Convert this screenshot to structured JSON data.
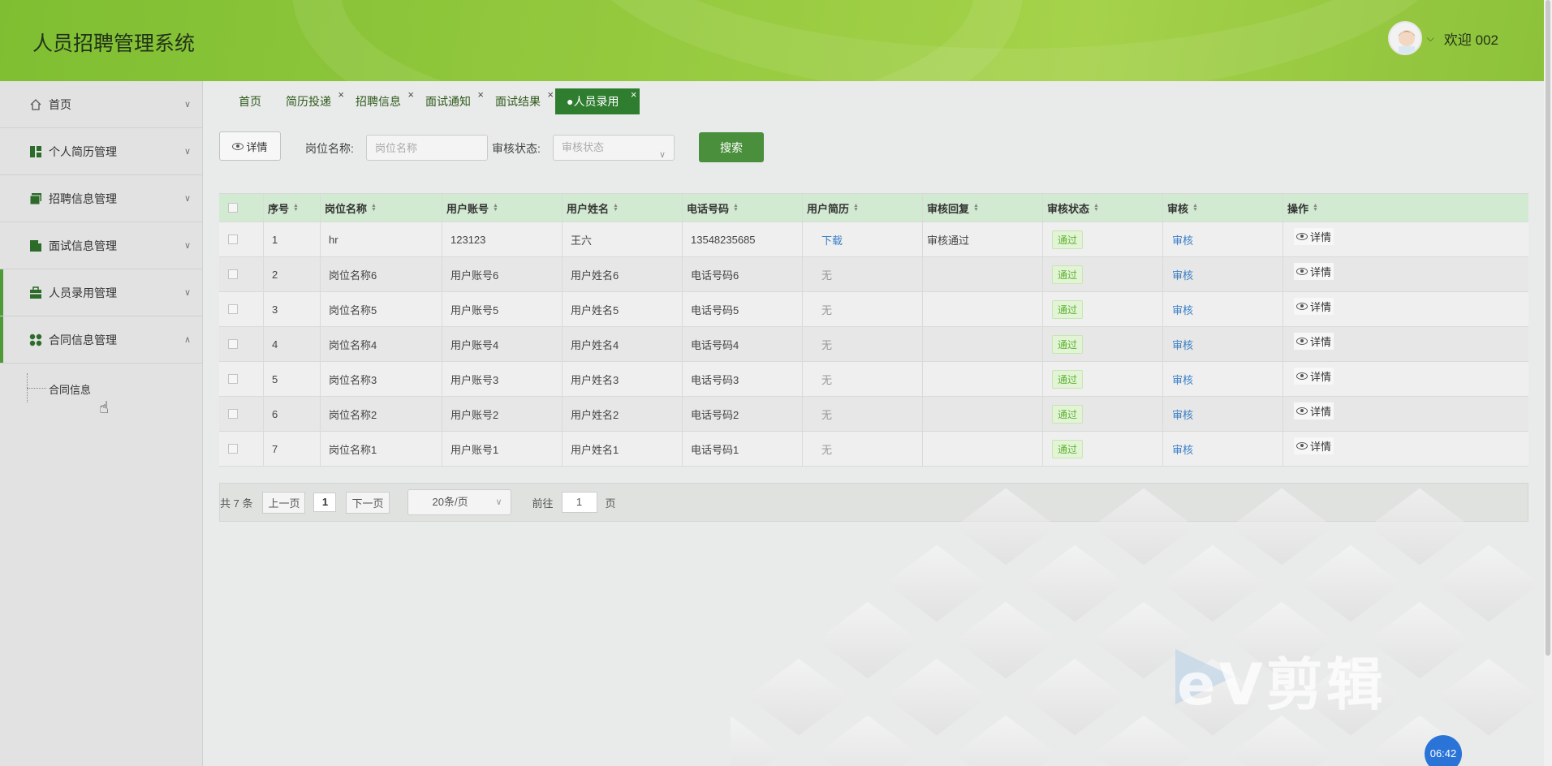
{
  "app": {
    "title": "人员招聘管理系统",
    "welcome": "欢迎 002"
  },
  "sidebar": {
    "items": [
      {
        "label": "首页",
        "icon": "home-icon"
      },
      {
        "label": "个人简历管理",
        "icon": "dashboard-icon"
      },
      {
        "label": "招聘信息管理",
        "icon": "folders-icon"
      },
      {
        "label": "面试信息管理",
        "icon": "document-icon"
      },
      {
        "label": "人员录用管理",
        "icon": "briefcase-icon"
      },
      {
        "label": "合同信息管理",
        "icon": "apps-icon"
      }
    ],
    "submenu": {
      "label": "合同信息"
    }
  },
  "tabs": [
    {
      "label": "首页"
    },
    {
      "label": "简历投递"
    },
    {
      "label": "招聘信息"
    },
    {
      "label": "面试通知"
    },
    {
      "label": "面试结果"
    },
    {
      "label": "●人员录用",
      "active": true
    }
  ],
  "toolbar": {
    "detail_label": "详情",
    "job_label": "岗位名称:",
    "job_placeholder": "岗位名称",
    "status_label": "审核状态:",
    "status_placeholder": "审核状态",
    "search_label": "搜索"
  },
  "table": {
    "headers": [
      "序号",
      "岗位名称",
      "用户账号",
      "用户姓名",
      "电话号码",
      "用户简历",
      "审核回复",
      "审核状态",
      "审核",
      "操作"
    ],
    "rows": [
      {
        "no": "1",
        "job": "hr",
        "account": "123123",
        "name": "王六",
        "phone": "13548235685",
        "resume": "下载",
        "reply": "审核通过",
        "status": "通过",
        "audit": "审核",
        "op": "详情"
      },
      {
        "no": "2",
        "job": "岗位名称6",
        "account": "用户账号6",
        "name": "用户姓名6",
        "phone": "电话号码6",
        "resume": "无",
        "reply": "",
        "status": "通过",
        "audit": "审核",
        "op": "详情"
      },
      {
        "no": "3",
        "job": "岗位名称5",
        "account": "用户账号5",
        "name": "用户姓名5",
        "phone": "电话号码5",
        "resume": "无",
        "reply": "",
        "status": "通过",
        "audit": "审核",
        "op": "详情"
      },
      {
        "no": "4",
        "job": "岗位名称4",
        "account": "用户账号4",
        "name": "用户姓名4",
        "phone": "电话号码4",
        "resume": "无",
        "reply": "",
        "status": "通过",
        "audit": "审核",
        "op": "详情"
      },
      {
        "no": "5",
        "job": "岗位名称3",
        "account": "用户账号3",
        "name": "用户姓名3",
        "phone": "电话号码3",
        "resume": "无",
        "reply": "",
        "status": "通过",
        "audit": "审核",
        "op": "详情"
      },
      {
        "no": "6",
        "job": "岗位名称2",
        "account": "用户账号2",
        "name": "用户姓名2",
        "phone": "电话号码2",
        "resume": "无",
        "reply": "",
        "status": "通过",
        "audit": "审核",
        "op": "详情"
      },
      {
        "no": "7",
        "job": "岗位名称1",
        "account": "用户账号1",
        "name": "用户姓名1",
        "phone": "电话号码1",
        "resume": "无",
        "reply": "",
        "status": "通过",
        "audit": "审核",
        "op": "详情"
      }
    ]
  },
  "pagination": {
    "total": "共 7 条",
    "prev": "上一页",
    "page": "1",
    "next": "下一页",
    "page_size": "20条/页",
    "goto": "前往",
    "goto_value": "1",
    "page_unit": "页"
  },
  "overlay": {
    "watermark": "eV剪辑",
    "clock": "06:42"
  },
  "colors": {
    "header": "#94c93e",
    "accent": "#2f7d2f",
    "link": "#3a7fc7",
    "badge": "#5bb22f"
  }
}
